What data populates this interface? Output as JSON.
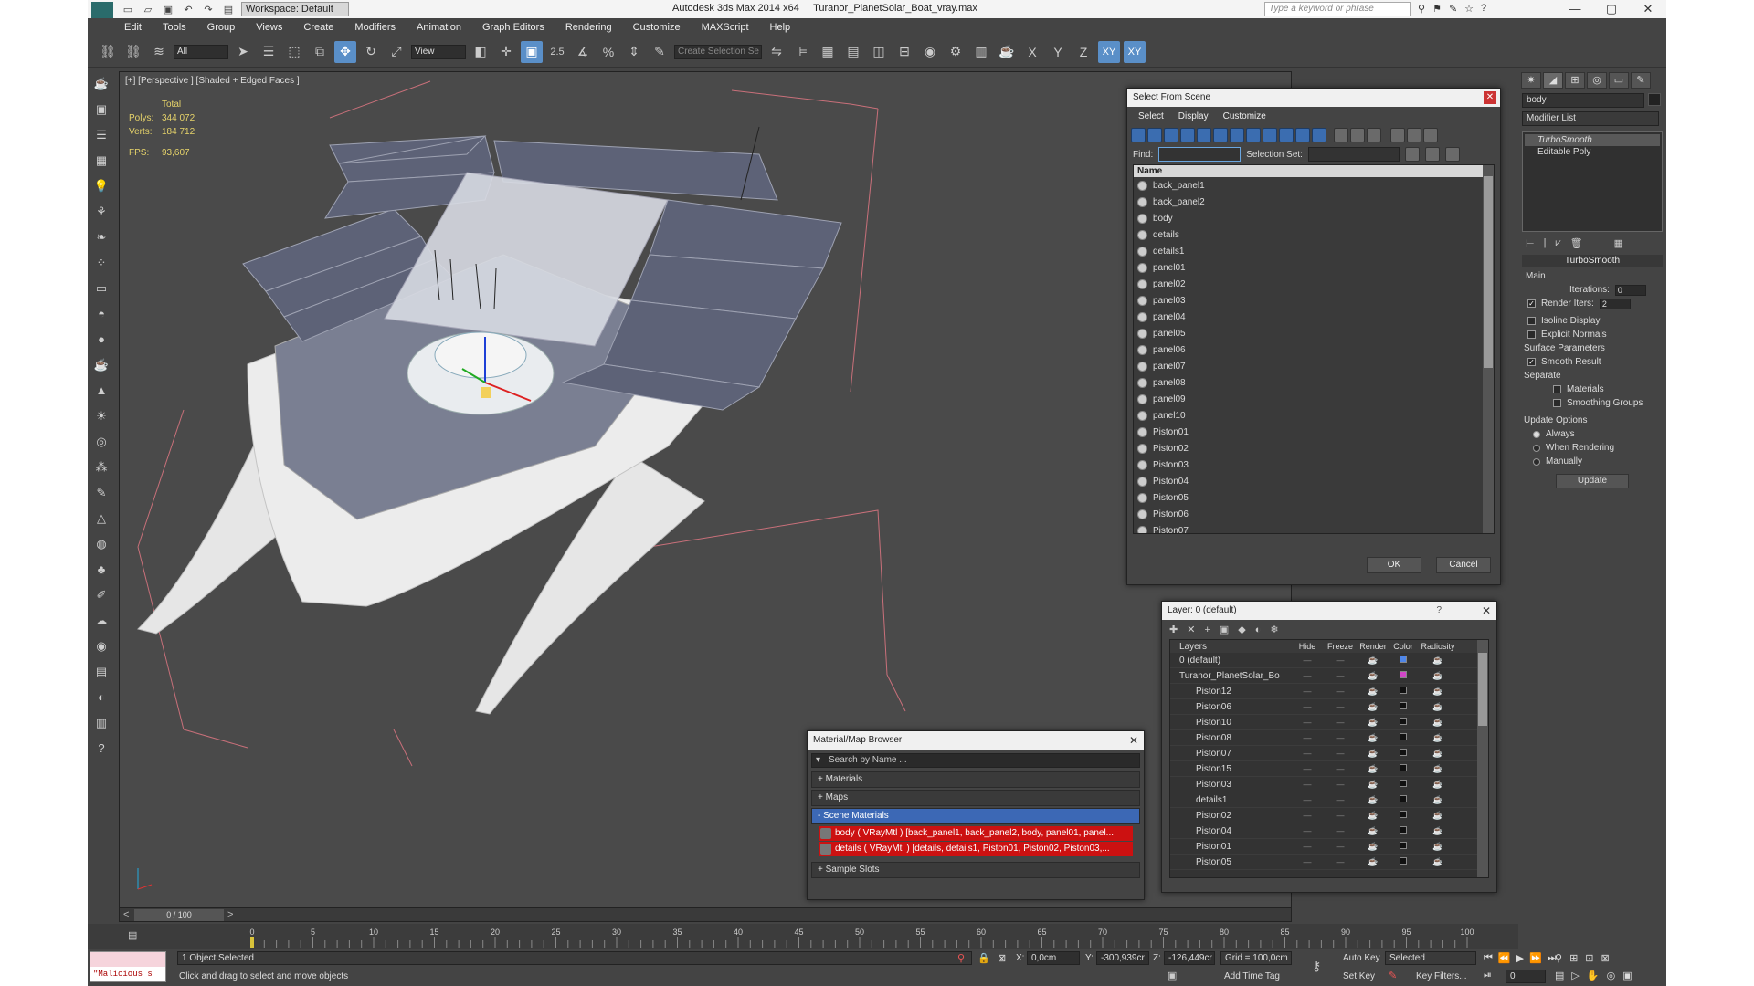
{
  "titlebar": {
    "workspace": "Workspace: Default",
    "app_title": "Autodesk 3ds Max  2014 x64",
    "file_name": "Turanor_PlanetSolar_Boat_vray.max",
    "search_placeholder": "Type a keyword or phrase"
  },
  "menu": [
    "Edit",
    "Tools",
    "Group",
    "Views",
    "Create",
    "Modifiers",
    "Animation",
    "Graph Editors",
    "Rendering",
    "Customize",
    "MAXScript",
    "Help"
  ],
  "toolbar": {
    "selection_filter": "All",
    "ref_coord": "View",
    "named_selection": "Create Selection Se",
    "snap_label": "2.5",
    "axis_x": "X",
    "axis_y": "Y",
    "axis_z": "Z",
    "axis_xy": "XY",
    "axis_xy2": "XY"
  },
  "viewport": {
    "label": "[+] [Perspective ] [Shaded + Edged Faces ]",
    "stats_total": "Total",
    "polys_label": "Polys:",
    "polys": "344 072",
    "verts_label": "Verts:",
    "verts": "184 712",
    "fps_label": "FPS:",
    "fps": "93,607"
  },
  "select_from_scene": {
    "title": "Select From Scene",
    "menu": [
      "Select",
      "Display",
      "Customize"
    ],
    "find_label": "Find:",
    "selection_set_label": "Selection Set:",
    "column_name": "Name",
    "items": [
      "back_panel1",
      "back_panel2",
      "body",
      "details",
      "details1",
      "panel01",
      "panel02",
      "panel03",
      "panel04",
      "panel05",
      "panel06",
      "panel07",
      "panel08",
      "panel09",
      "panel10",
      "Piston01",
      "Piston02",
      "Piston03",
      "Piston04",
      "Piston05",
      "Piston06",
      "Piston07"
    ],
    "ok": "OK",
    "cancel": "Cancel"
  },
  "layers": {
    "title": "Layer: 0 (default)",
    "help": "?",
    "columns": [
      "Layers",
      "Hide",
      "Freeze",
      "Render",
      "Color",
      "Radiosity"
    ],
    "rows": [
      {
        "name": "0 (default)",
        "color": "#4f86e8"
      },
      {
        "name": "Turanor_PlanetSolar_Bo",
        "color": "#d246c8"
      },
      {
        "name": "Piston12",
        "color": "#111111"
      },
      {
        "name": "Piston06",
        "color": "#111111"
      },
      {
        "name": "Piston10",
        "color": "#111111"
      },
      {
        "name": "Piston08",
        "color": "#111111"
      },
      {
        "name": "Piston07",
        "color": "#111111"
      },
      {
        "name": "Piston15",
        "color": "#111111"
      },
      {
        "name": "Piston03",
        "color": "#111111"
      },
      {
        "name": "details1",
        "color": "#111111"
      },
      {
        "name": "Piston02",
        "color": "#111111"
      },
      {
        "name": "Piston04",
        "color": "#111111"
      },
      {
        "name": "Piston01",
        "color": "#111111"
      },
      {
        "name": "Piston05",
        "color": "#111111"
      }
    ]
  },
  "material_browser": {
    "title": "Material/Map Browser",
    "search_placeholder": "Search by Name ...",
    "sections": [
      "+ Materials",
      "+ Maps",
      "- Scene Materials"
    ],
    "scene_items": [
      "body  ( VRayMtl ) [back_panel1, back_panel2, body, panel01, panel...",
      "details  ( VRayMtl ) [details, details1, Piston01, Piston02, Piston03,..."
    ],
    "sample_slots": "+ Sample Slots"
  },
  "command_panel": {
    "object_name": "body",
    "modifier_list": "Modifier List",
    "modifiers": [
      "TurboSmooth",
      "Editable Poly"
    ],
    "rollout_title": "TurboSmooth",
    "main_label": "Main",
    "iterations_label": "Iterations:",
    "iterations": "0",
    "render_iters_label": "Render Iters:",
    "render_iters": "2",
    "isoline": "Isoline Display",
    "explicit": "Explicit Normals",
    "surface_params": "Surface Parameters",
    "smooth_result": "Smooth Result",
    "separate": "Separate",
    "materials": "Materials",
    "smoothing_groups": "Smoothing Groups",
    "update_options": "Update Options",
    "always": "Always",
    "when_rendering": "When Rendering",
    "manually": "Manually",
    "update_btn": "Update"
  },
  "timeline": {
    "frame": "0 / 100",
    "ticks": [
      "0",
      "5",
      "10",
      "15",
      "20",
      "25",
      "30",
      "35",
      "40",
      "45",
      "50",
      "55",
      "60",
      "65",
      "70",
      "75",
      "80",
      "85",
      "90",
      "95",
      "100"
    ]
  },
  "status": {
    "maxscript": "\"Malicious s",
    "selected": "1 Object Selected",
    "prompt": "Click and drag to select and move objects",
    "x_label": "X:",
    "x": "0,0cm",
    "y_label": "Y:",
    "y": "-300,939cr",
    "z_label": "Z:",
    "z": "-126,449cr",
    "grid": "Grid = 100,0cm",
    "add_time_tag": "Add Time Tag",
    "auto_key": "Auto Key",
    "key_mode": "Selected",
    "set_key": "Set Key",
    "key_filters": "Key Filters...",
    "frame_field": "0"
  }
}
